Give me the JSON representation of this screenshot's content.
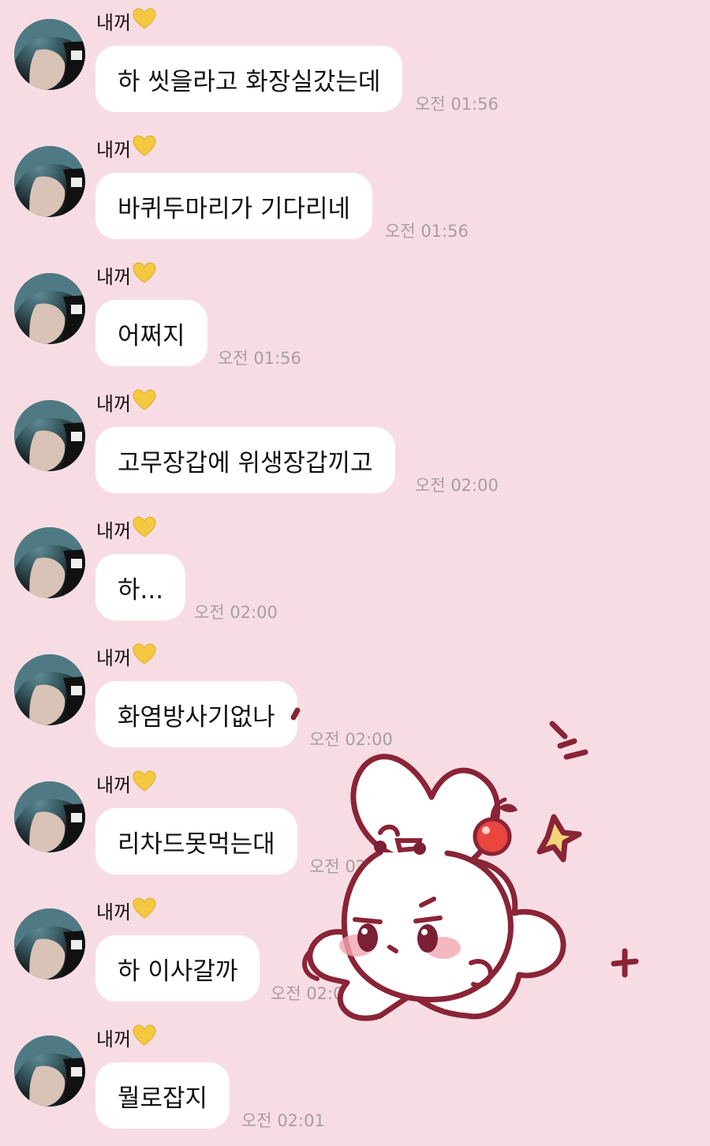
{
  "chat": {
    "messages": [
      {
        "sender": "내꺼",
        "text": "하 씻을라고 화장실갔는데",
        "time": "오전 01:56"
      },
      {
        "sender": "내꺼",
        "text": "바퀴두마리가 기다리네",
        "time": "오전 01:56"
      },
      {
        "sender": "내꺼",
        "text": "어쩌지",
        "time": "오전 01:56"
      },
      {
        "sender": "내꺼",
        "text": "고무장갑에 위생장갑끼고",
        "time": "오전 02:00"
      },
      {
        "sender": "내꺼",
        "text": "하...",
        "time": "오전 02:00"
      },
      {
        "sender": "내꺼",
        "text": "화염방사기없나",
        "time": "오전 02:00"
      },
      {
        "sender": "내꺼",
        "text": "리차드못먹는대",
        "time": "오전 02:00"
      },
      {
        "sender": "내꺼",
        "text": "하 이사갈까",
        "time": "오전 02:00"
      },
      {
        "sender": "내꺼",
        "text": "뭘로잡지",
        "time": "오전 02:01"
      }
    ],
    "sender_icon": "yellow-heart-icon",
    "sticker": "bunny-cherry-sticker"
  },
  "colors": {
    "background": "#f7dde3",
    "bubble": "#ffffff",
    "timestamp": "#a69ea1",
    "heart": "#f5c842",
    "sticker_outline": "#8a2436",
    "cherry": "#e8463e"
  }
}
